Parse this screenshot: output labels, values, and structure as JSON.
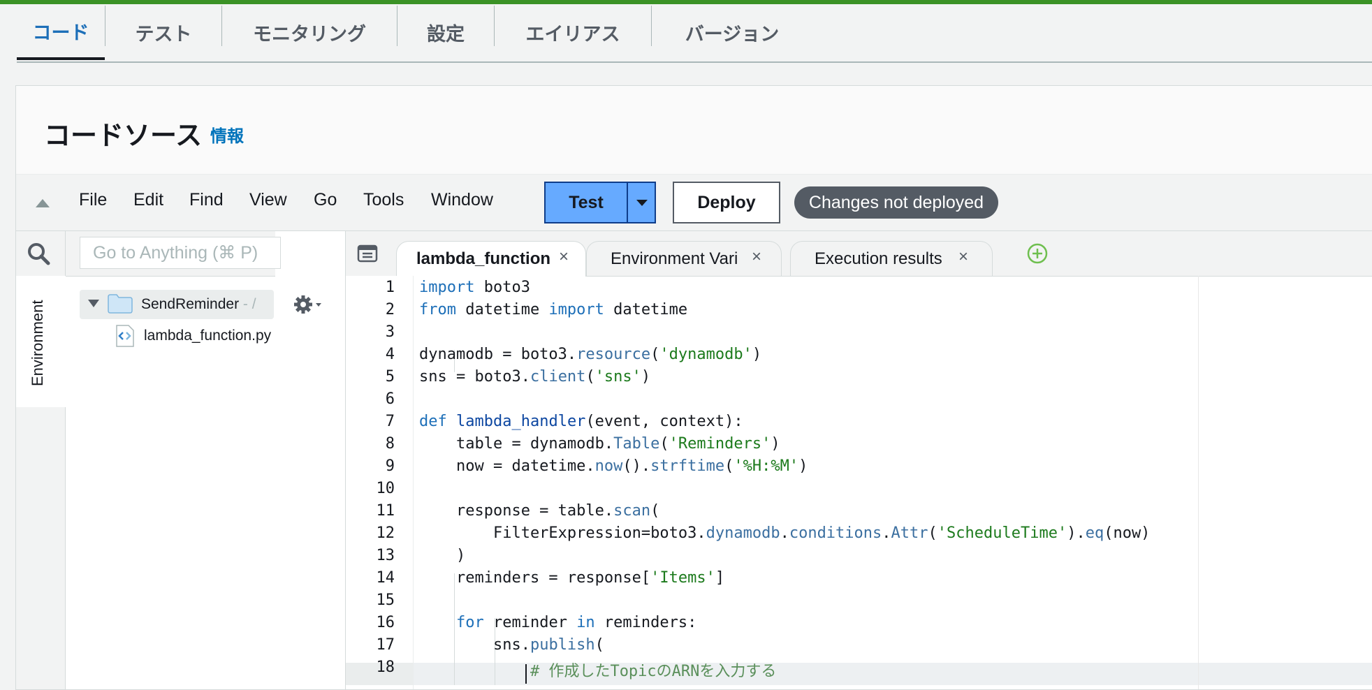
{
  "colors": {
    "accent_green": "#3b9226",
    "link_blue": "#0073bb",
    "test_button": "#66aaff",
    "badge_bg": "#545b64"
  },
  "nav_tabs": [
    {
      "label": "コード",
      "active": true
    },
    {
      "label": "テスト"
    },
    {
      "label": "モニタリング"
    },
    {
      "label": "設定"
    },
    {
      "label": "エイリアス"
    },
    {
      "label": "バージョン"
    }
  ],
  "panel": {
    "title": "コードソース",
    "info_link": "情報"
  },
  "menubar": {
    "items": [
      "File",
      "Edit",
      "Find",
      "View",
      "Go",
      "Tools",
      "Window"
    ],
    "test_label": "Test",
    "deploy_label": "Deploy",
    "status_badge": "Changes not deployed"
  },
  "sidebar": {
    "search_placeholder": "Go to Anything (⌘ P)",
    "environment_label": "Environment",
    "root_folder": "SendReminder",
    "root_path": " - /",
    "file": "lambda_function.py"
  },
  "editor_tabs": [
    {
      "label": "lambda_function",
      "active": true
    },
    {
      "label": "Environment Vari"
    },
    {
      "label": "Execution results"
    }
  ],
  "icons": [
    "collapse-up-icon",
    "search-icon",
    "folder-icon",
    "gear-icon",
    "python-file-icon",
    "tabs-menu-icon",
    "close-icon",
    "add-tab-icon",
    "chevron-down-icon"
  ],
  "code": {
    "line_numbers": [
      "1",
      "2",
      "3",
      "4",
      "5",
      "6",
      "7",
      "8",
      "9",
      "10",
      "11",
      "12",
      "13",
      "14",
      "15",
      "16",
      "17",
      "18"
    ],
    "lines": [
      "import boto3",
      "from datetime import datetime",
      "",
      "dynamodb = boto3.resource('dynamodb')",
      "sns = boto3.client('sns')",
      "",
      "def lambda_handler(event, context):",
      "    table = dynamodb.Table('Reminders')",
      "    now = datetime.now().strftime('%H:%M')",
      "",
      "    response = table.scan(",
      "        FilterExpression=boto3.dynamodb.conditions.Attr('ScheduleTime').eq(now)",
      "    )",
      "    reminders = response['Items']",
      "",
      "    for reminder in reminders:",
      "        sns.publish(",
      "            # 作成したTopicのARNを入力する"
    ],
    "active_line": 18
  }
}
